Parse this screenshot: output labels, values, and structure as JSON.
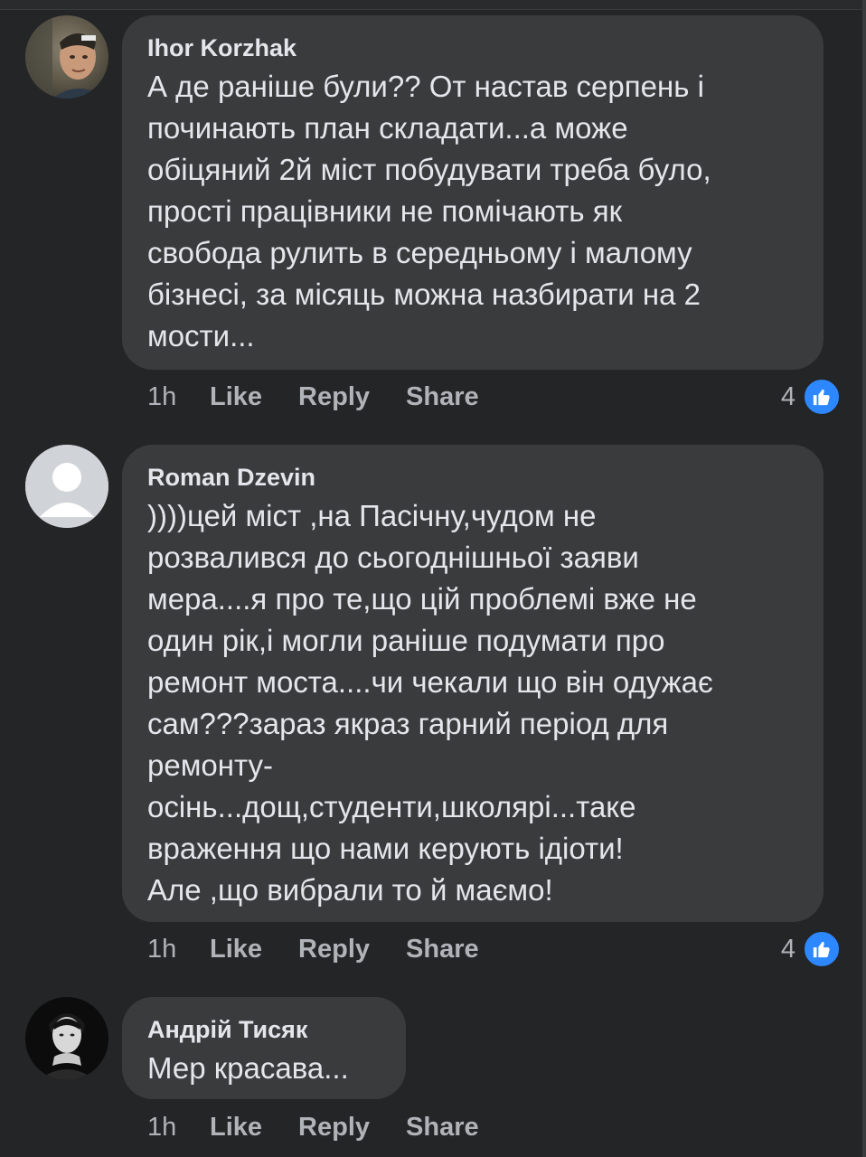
{
  "comments": [
    {
      "author": "Ihor Korzhak",
      "text": "А де раніше були?? От настав серпень і\nпочинають план складати...а може\nобіцяний 2й міст побудувати треба було,\nпрості працівники не помічають як\nсвобода рулить в середньому і малому\nбізнесі, за місяць можна назбирати на 2\nмости...",
      "time": "1h",
      "like_label": "Like",
      "reply_label": "Reply",
      "share_label": "Share",
      "reaction_count": "4"
    },
    {
      "author": "Roman Dzevin",
      "text": "))))цей міст ,на Пасічну,чудом не\nрозвалився до сьогоднішньої заяви\nмера....я про те,що цій проблемі вже не\nодин рік,і могли раніше подумати про\nремонт моста....чи чекали що він одужає\nсам???зараз якраз гарний період для\nремонту-\nосінь...дощ,студенти,школярі...таке\nвраження що нами керують ідіоти!\nАле ,що вибрали то й маємо!",
      "time": "1h",
      "like_label": "Like",
      "reply_label": "Reply",
      "share_label": "Share",
      "reaction_count": "4"
    },
    {
      "author": "Андрій Тисяк",
      "text": "Мер красава...",
      "time": "1h",
      "like_label": "Like",
      "reply_label": "Reply",
      "share_label": "Share"
    }
  ],
  "colors": {
    "background": "#242526",
    "bubble": "#3a3b3c",
    "text": "#e4e6eb",
    "secondary_text": "#b0b3b8",
    "like_blue": "#2d88ff"
  },
  "icons": {
    "like_badge": "thumbs-up-icon",
    "default_avatar": "person-silhouette-icon"
  }
}
